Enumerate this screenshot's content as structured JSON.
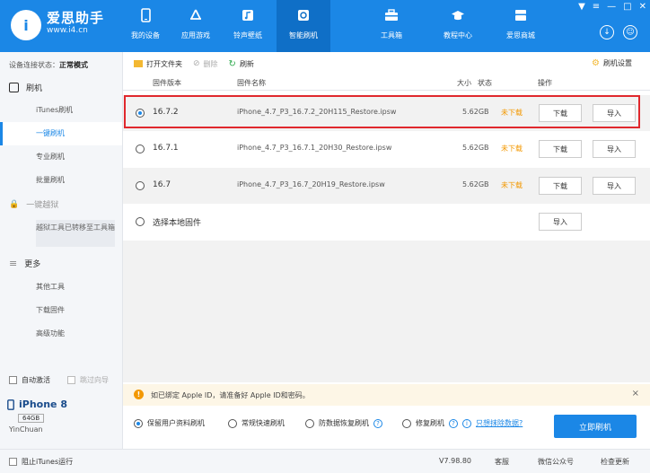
{
  "brand": {
    "logo_text": "i",
    "name": "爱思助手",
    "url": "www.i4.cn"
  },
  "nav": [
    {
      "label": "我的设备",
      "icon": "phone-icon"
    },
    {
      "label": "应用游戏",
      "icon": "app-store-icon"
    },
    {
      "label": "铃声壁纸",
      "icon": "music-icon"
    },
    {
      "label": "智能刷机",
      "icon": "refresh-icon"
    },
    {
      "label": "工具箱",
      "icon": "toolbox-icon"
    },
    {
      "label": "教程中心",
      "icon": "graduation-cap-icon"
    },
    {
      "label": "爱思商城",
      "icon": "store-icon"
    }
  ],
  "window_controls": [
    "▼",
    "≡",
    "—",
    "□",
    "✕"
  ],
  "sidebar": {
    "status_label": "设备连接状态：",
    "status_value": "正常模式",
    "flash_header": "刷机",
    "items": [
      "iTunes刷机",
      "一键刷机",
      "专业刷机",
      "批量刷机"
    ],
    "jailbreak_header": "一键越狱",
    "jailbreak_note": "越狱工具已转移至工具箱",
    "more_header": "更多",
    "more_items": [
      "其他工具",
      "下载固件",
      "高级功能"
    ],
    "auto_activate": "自动激活",
    "skip_guide": "跳过向导",
    "device_name": "iPhone 8",
    "capacity": "64GB",
    "owner": "YinChuan"
  },
  "toolbar": {
    "open_folder": "打开文件夹",
    "delete": "删除",
    "refresh": "刷新",
    "settings": "刷机设置"
  },
  "table": {
    "headers": {
      "version": "固件版本",
      "name": "固件名称",
      "size": "大小",
      "status": "状态",
      "action": "操作"
    },
    "rows": [
      {
        "version": "16.7.2",
        "name": "iPhone_4.7_P3_16.7.2_20H115_Restore.ipsw",
        "size": "5.62GB",
        "status": "未下载",
        "download": "下载",
        "import": "导入",
        "selected": true
      },
      {
        "version": "16.7.1",
        "name": "iPhone_4.7_P3_16.7.1_20H30_Restore.ipsw",
        "size": "5.62GB",
        "status": "未下载",
        "download": "下载",
        "import": "导入",
        "selected": false
      },
      {
        "version": "16.7",
        "name": "iPhone_4.7_P3_16.7_20H19_Restore.ipsw",
        "size": "5.62GB",
        "status": "未下载",
        "download": "下载",
        "import": "导入",
        "selected": false
      }
    ],
    "local": {
      "label": "选择本地固件",
      "import": "导入"
    }
  },
  "notice": {
    "text": "如已绑定 Apple ID，请准备好 Apple ID和密码。",
    "close": "×"
  },
  "options": {
    "keep_data": "保留用户资料刷机",
    "quick": "常规快速刷机",
    "anti_recovery": "防数据恢复刷机",
    "repair": "修复刷机",
    "erase_link": "只想抹除数据?",
    "flash_button": "立即刷机"
  },
  "footer": {
    "block_itunes": "阻止iTunes运行",
    "version": "V7.98.80",
    "support": "客服",
    "wechat": "微信公众号",
    "update": "检查更新"
  },
  "colors": {
    "accent": "#1b87e6",
    "highlight": "#e0282d",
    "warning": "#f39800"
  }
}
